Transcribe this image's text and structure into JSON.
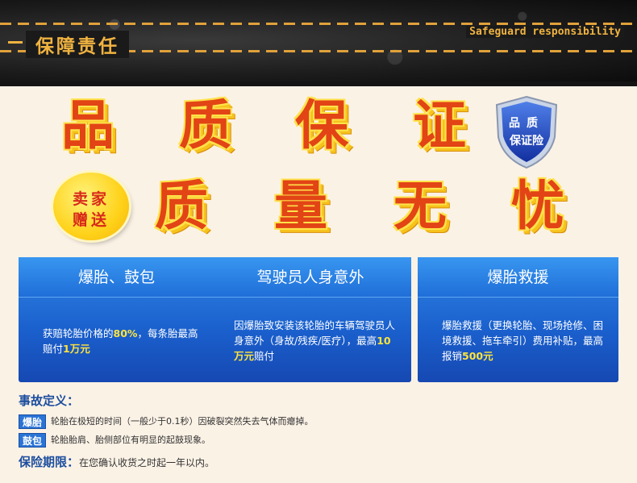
{
  "header": {
    "title_cn": "保障责任",
    "title_en": "Safeguard responsibility"
  },
  "headline": {
    "line1": [
      "品",
      "质",
      "保",
      "证"
    ],
    "line2": [
      "质",
      "量",
      "无",
      "忧"
    ]
  },
  "shield_badge": {
    "line1": "品质",
    "line2": "保证险",
    "icon": "shield-icon"
  },
  "gift_badge": {
    "line1": "卖家",
    "line2": "赠送"
  },
  "cards": [
    {
      "title": "爆胎、鼓包",
      "body_pre": "获赔轮胎价格的",
      "body_hl1": "80%",
      "body_mid": "，每条胎最高赔付",
      "body_hl2": "1万元",
      "body_post": ""
    },
    {
      "title": "驾驶员人身意外",
      "body_pre": "因爆胎致安装该轮胎的车辆驾驶员人身意外（身故/残疾/医疗），最高",
      "body_hl1": "10万元",
      "body_mid": "赔付",
      "body_hl2": "",
      "body_post": ""
    },
    {
      "title": "爆胎救援",
      "body_pre": "爆胎救援（更换轮胎、现场抢修、困境救援、拖车牵引）费用补贴，最高报销",
      "body_hl1": "500元",
      "body_mid": "",
      "body_hl2": "",
      "body_post": ""
    }
  ],
  "definitions": {
    "title": "事故定义：",
    "items": [
      {
        "tag": "爆胎",
        "desc": "轮胎在极短的时间（一般少于0.1秒）因破裂突然失去气体而瘪掉。"
      },
      {
        "tag": "鼓包",
        "desc": "轮胎胎肩、胎侧部位有明显的起鼓现象。"
      }
    ]
  },
  "period": {
    "label": "保险期限：",
    "text": "在您确认收货之时起一年以内。"
  },
  "colors": {
    "accent_orange": "#e24415",
    "accent_yellow": "#ffe24a",
    "card_blue": "#1f6ed8",
    "header_gold": "#f0b341"
  }
}
